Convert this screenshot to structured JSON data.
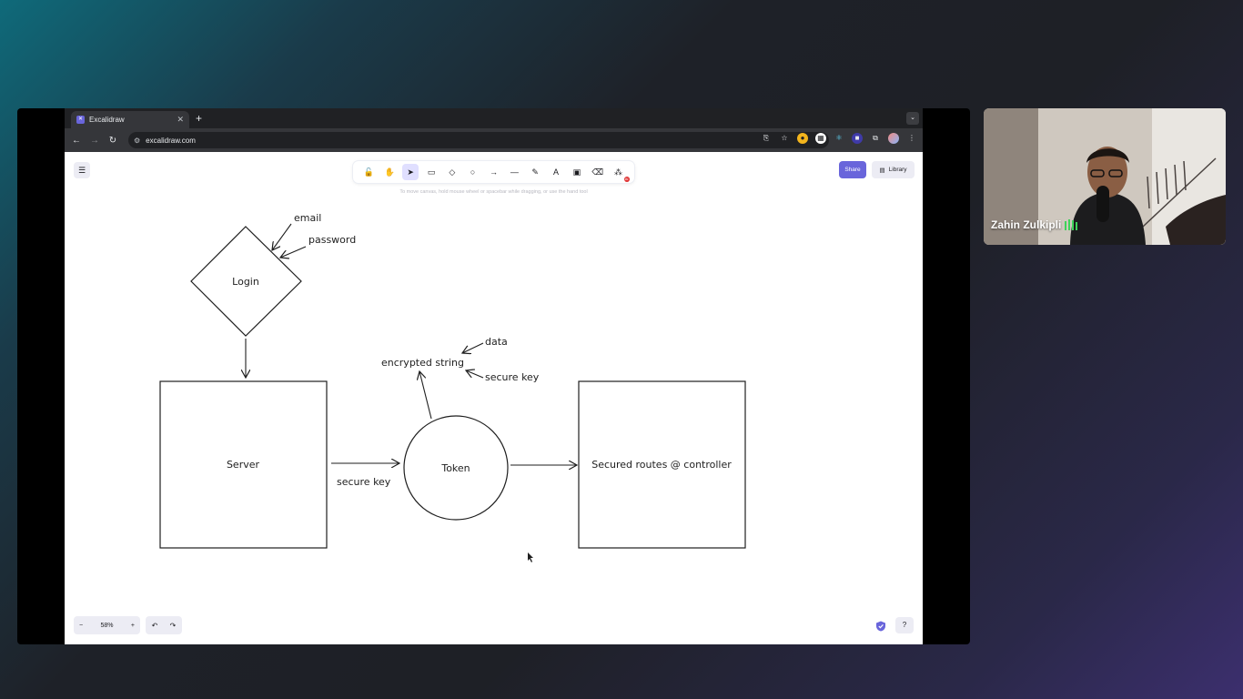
{
  "browser": {
    "tab_title": "Excalidraw",
    "url": "excalidraw.com"
  },
  "excalidraw": {
    "hint": "To move canvas, hold mouse wheel or spacebar while dragging, or use the hand tool",
    "share_label": "Share",
    "library_label": "Library",
    "zoom_level": "58%",
    "tools": [
      {
        "name": "lock",
        "glyph": "🔓"
      },
      {
        "name": "hand",
        "glyph": "✋"
      },
      {
        "name": "selection",
        "glyph": "➤"
      },
      {
        "name": "rectangle",
        "glyph": "▭"
      },
      {
        "name": "diamond",
        "glyph": "◇"
      },
      {
        "name": "ellipse",
        "glyph": "○"
      },
      {
        "name": "arrow",
        "glyph": "→"
      },
      {
        "name": "line",
        "glyph": "—"
      },
      {
        "name": "draw",
        "glyph": "✎"
      },
      {
        "name": "text",
        "glyph": "A"
      },
      {
        "name": "image",
        "glyph": "▣"
      },
      {
        "name": "eraser",
        "glyph": "⌫"
      },
      {
        "name": "more-tools",
        "glyph": "⁂"
      }
    ],
    "active_tool": "selection",
    "accent_color": "#6965db"
  },
  "diagram": {
    "login": "Login",
    "email": "email",
    "password": "password",
    "server": "Server",
    "secure_key_1": "secure key",
    "token": "Token",
    "encrypted_string": "encrypted string",
    "data": "data",
    "secure_key_2": "secure key",
    "secured_routes": "Secured routes @ controller"
  },
  "video": {
    "participant_name": "Zahin Zulkipli"
  }
}
